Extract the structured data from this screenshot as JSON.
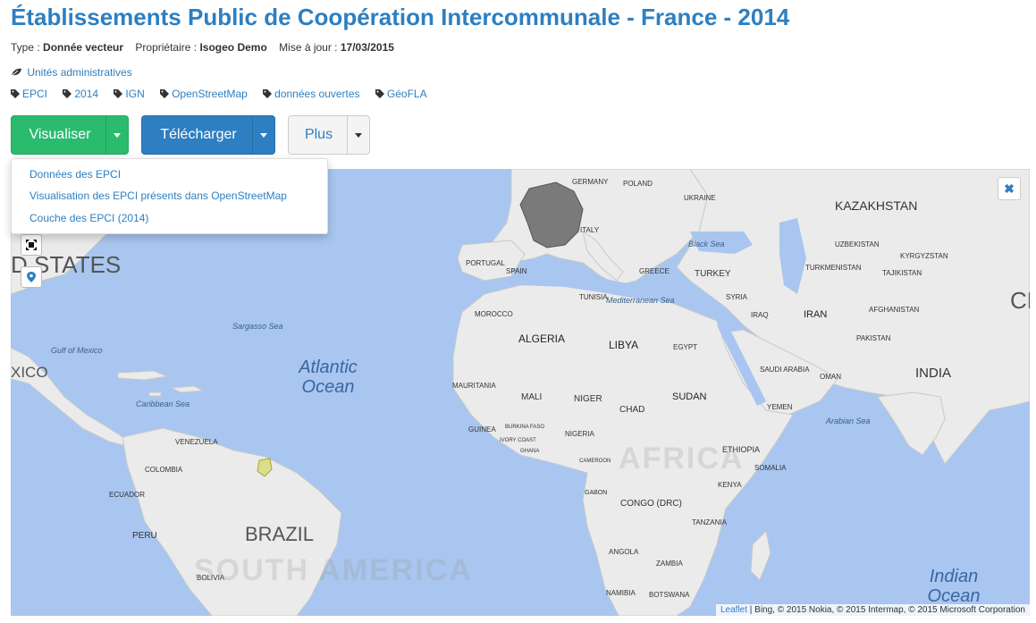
{
  "header": {
    "title": "Établissements Public de Coopération Intercommunale - France - 2014",
    "type_label": "Type :",
    "type_value": "Donnée vecteur",
    "owner_label": "Propriétaire :",
    "owner_value": "Isogeo Demo",
    "update_label": "Mise à jour :",
    "update_value": "17/03/2015"
  },
  "theme": {
    "label": "Unités administratives",
    "icon": "leaf-icon"
  },
  "tags": [
    "EPCI",
    "2014",
    "IGN",
    "OpenStreetMap",
    "données ouvertes",
    "GéoFLA"
  ],
  "buttons": {
    "visualize": "Visualiser",
    "download": "Télécharger",
    "more": "Plus"
  },
  "dropdown": {
    "items": [
      "Données des EPCI",
      "Visualisation des EPCI présents dans OpenStreetMap",
      "Couche des EPCI (2014)"
    ]
  },
  "colors": {
    "accent": "#2d7fc1",
    "visualize_button": "#2bbb6f",
    "download_button": "#2d7fc1",
    "water": "#a8c6ef",
    "land": "#ebebeb"
  },
  "map": {
    "labels": {
      "states": "D STATES",
      "mexico": "XICO",
      "gulf_mexico": "Gulf of Mexico",
      "sargasso": "Sargasso Sea",
      "caribbean": "Caribbean Sea",
      "atlantic": "Atlantic Ocean",
      "venezuela": "VENEZUELA",
      "colombia": "COLOMBIA",
      "ecuador": "ECUADOR",
      "peru": "PERU",
      "brazil": "BRAZIL",
      "bolivia": "BOLIVIA",
      "south_america": "SOUTH AMERICA",
      "germany": "GERMANY",
      "poland": "POLAND",
      "ukraine": "UKRAINE",
      "italy": "ITALY",
      "portugal": "PORTUGAL",
      "spain": "SPAIN",
      "greece": "GREECE",
      "turkey": "TURKEY",
      "black_sea": "Black Sea",
      "kazakhstan": "KAZAKHSTAN",
      "uzbekistan": "UZBEKISTAN",
      "kyrgyzstan": "KYRGYZSTAN",
      "turkmenistan": "TURKMENISTAN",
      "tajikistan": "TAJIKISTAN",
      "china": "CH",
      "afghanistan": "AFGHANISTAN",
      "pakistan": "PAKISTAN",
      "iran": "IRAN",
      "iraq": "IRAQ",
      "syria": "SYRIA",
      "mediterranean": "Mediterranean Sea",
      "tunisia": "TUNISIA",
      "morocco": "MOROCCO",
      "algeria": "ALGERIA",
      "libya": "LIBYA",
      "egypt": "EGYPT",
      "mauritania": "MAURITANIA",
      "mali": "MALI",
      "niger": "NIGER",
      "chad": "CHAD",
      "sudan": "SUDAN",
      "saudi": "SAUDI ARABIA",
      "oman": "OMAN",
      "yemen": "YEMEN",
      "india": "INDIA",
      "arabian_sea": "Arabian Sea",
      "ethiopia": "ETHIOPIA",
      "somalia": "SOMALIA",
      "kenya": "KENYA",
      "nigeria": "NIGERIA",
      "guinea": "GUINEA",
      "burkina": "BURKINA FASO",
      "ivory": "IVORY COAST",
      "ghana": "GHANA",
      "cameroon": "CAMEROON",
      "gabon": "GABON",
      "congo": "CONGO (DRC)",
      "tanzania": "TANZANIA",
      "angola": "ANGOLA",
      "zambia": "ZAMBIA",
      "namibia": "NAMIBIA",
      "botswana": "BOTSWANA",
      "africa": "AFRICA",
      "indian_ocean": "Indian Ocean"
    },
    "attribution_link": "Leaflet",
    "attribution_text": " | Bing, © 2015 Nokia, © 2015 Intermap, © 2015 Microsoft Corporation"
  }
}
